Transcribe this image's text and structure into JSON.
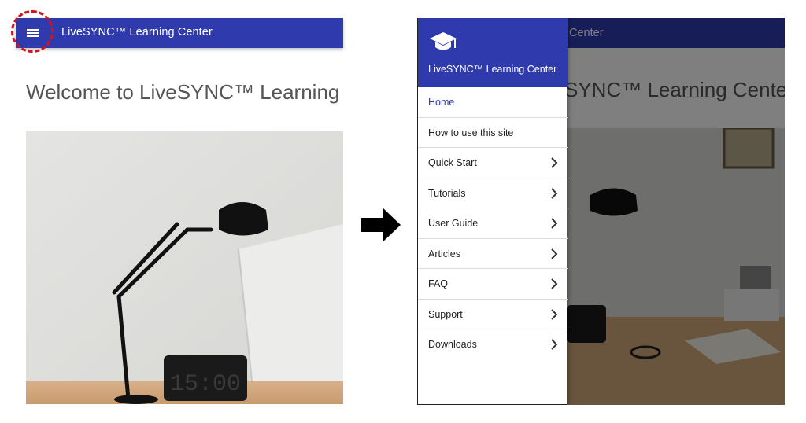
{
  "app": {
    "title": "LiveSYNC™ Learning Center",
    "title_partial": "Center",
    "welcome": "Welcome to LiveSYNC™ Learning Center",
    "welcome_partial": "SYNC™ Learning Center"
  },
  "clock_display": "15:00",
  "drawer": {
    "header_title": "LiveSYNC™ Learning Center",
    "items": [
      {
        "label": "Home",
        "active": true,
        "has_submenu": false
      },
      {
        "label": "How to use this site",
        "active": false,
        "has_submenu": false
      },
      {
        "label": "Quick Start",
        "active": false,
        "has_submenu": true
      },
      {
        "label": "Tutorials",
        "active": false,
        "has_submenu": true
      },
      {
        "label": "User Guide",
        "active": false,
        "has_submenu": true
      },
      {
        "label": "Articles",
        "active": false,
        "has_submenu": true
      },
      {
        "label": "FAQ",
        "active": false,
        "has_submenu": true
      },
      {
        "label": "Support",
        "active": false,
        "has_submenu": true
      },
      {
        "label": "Downloads",
        "active": false,
        "has_submenu": true
      }
    ]
  },
  "colors": {
    "appbar": "#2f3aad",
    "highlight": "#d0141c",
    "active_item": "#2f3aad"
  },
  "icons": {
    "menu": "hamburger-menu-icon",
    "logo": "graduation-cap-icon",
    "chevron": "chevron-right-icon",
    "transition": "arrow-right-icon"
  }
}
